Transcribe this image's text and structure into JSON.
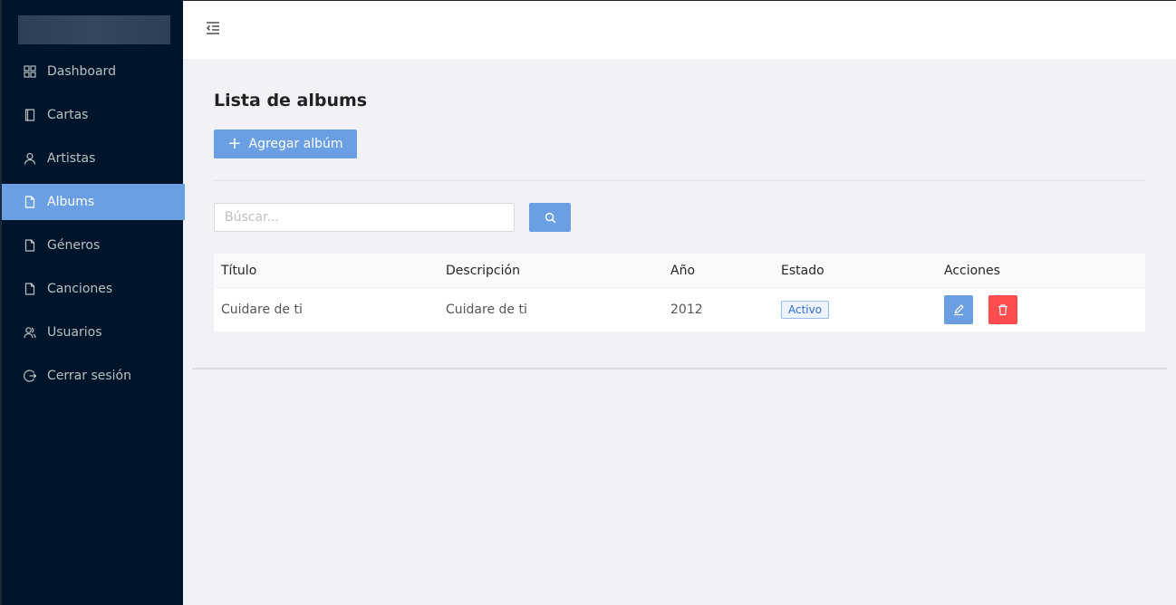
{
  "sidebar": {
    "items": [
      {
        "label": "Dashboard",
        "icon": "dashboard-icon"
      },
      {
        "label": "Cartas",
        "icon": "book-icon"
      },
      {
        "label": "Artistas",
        "icon": "user-icon"
      },
      {
        "label": "Albums",
        "icon": "file-icon",
        "active": true
      },
      {
        "label": "Géneros",
        "icon": "file-icon"
      },
      {
        "label": "Canciones",
        "icon": "file-icon"
      },
      {
        "label": "Usuarios",
        "icon": "team-icon"
      },
      {
        "label": "Cerrar sesión",
        "icon": "logout-icon"
      }
    ]
  },
  "page": {
    "title": "Lista de albums",
    "add_button_label": "Agregar albúm"
  },
  "search": {
    "placeholder": "Búscar...",
    "value": ""
  },
  "table": {
    "columns": [
      "Título",
      "Descripción",
      "Año",
      "Estado",
      "Acciones"
    ],
    "rows": [
      {
        "titulo": "Cuidare de ti",
        "descripcion": "Cuidare de ti",
        "anio": "2012",
        "estado": "Activo"
      }
    ]
  },
  "colors": {
    "sidebar_bg": "#001529",
    "primary": "#6b9fe3",
    "danger": "#ff4d4f",
    "page_bg": "#f0f2f5"
  }
}
